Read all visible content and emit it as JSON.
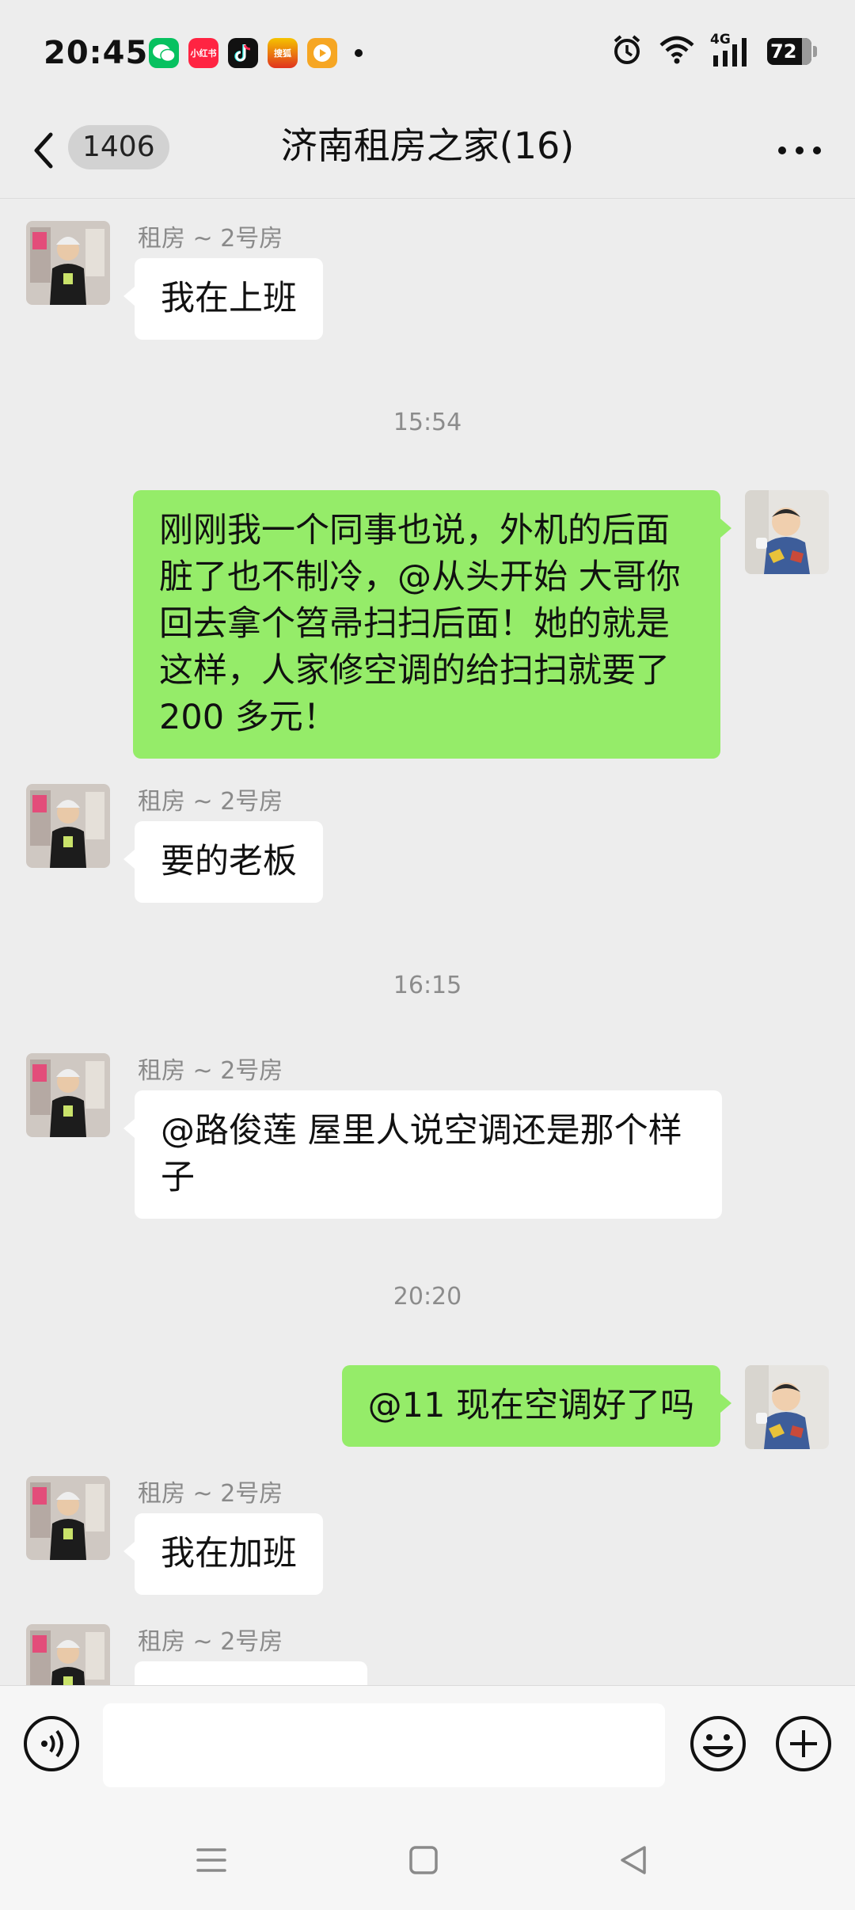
{
  "status_bar": {
    "time": "20:45",
    "apps": [
      {
        "icon": "wechat-icon",
        "color": "#07c160"
      },
      {
        "icon": "xiaohongshu-icon",
        "color": "#ff2442",
        "text": "小红书"
      },
      {
        "icon": "douyin-icon",
        "color": "#111111"
      },
      {
        "icon": "search-app-icon",
        "color": "#e0321e",
        "text": "搜狐"
      },
      {
        "icon": "video-app-icon",
        "color": "#f6a623"
      }
    ],
    "network": "4G",
    "battery": "72"
  },
  "header": {
    "unread_count": "1406",
    "title": "济南租房之家(16)"
  },
  "messages": [
    {
      "side": "left",
      "sender": "租房 ~ 2号房",
      "text": "我在上班"
    },
    {
      "type": "timestamp",
      "text": "15:54"
    },
    {
      "side": "right",
      "text": "刚刚我一个同事也说，外机的后面脏了也不制冷，@从头开始  大哥你回去拿个笤帚扫扫后面！她的就是这样，人家修空调的给扫扫就要了 200 多元！"
    },
    {
      "side": "left",
      "sender": "租房 ~ 2号房",
      "text": "要的老板"
    },
    {
      "type": "timestamp",
      "text": "16:15"
    },
    {
      "side": "left",
      "sender": "租房 ~ 2号房",
      "text": "@路俊莲  屋里人说空调还是那个样子"
    },
    {
      "type": "timestamp",
      "text": "20:20"
    },
    {
      "side": "right",
      "text": "@11  现在空调好了吗"
    },
    {
      "side": "left",
      "sender": "租房 ~ 2号房",
      "text": "我在加班"
    },
    {
      "side": "left",
      "sender": "租房 ~ 2号房",
      "text": ""
    }
  ],
  "input": {
    "value": "",
    "placeholder": ""
  },
  "colors": {
    "background": "#ededed",
    "bubble_self": "#95ec69",
    "bubble_other": "#ffffff"
  }
}
